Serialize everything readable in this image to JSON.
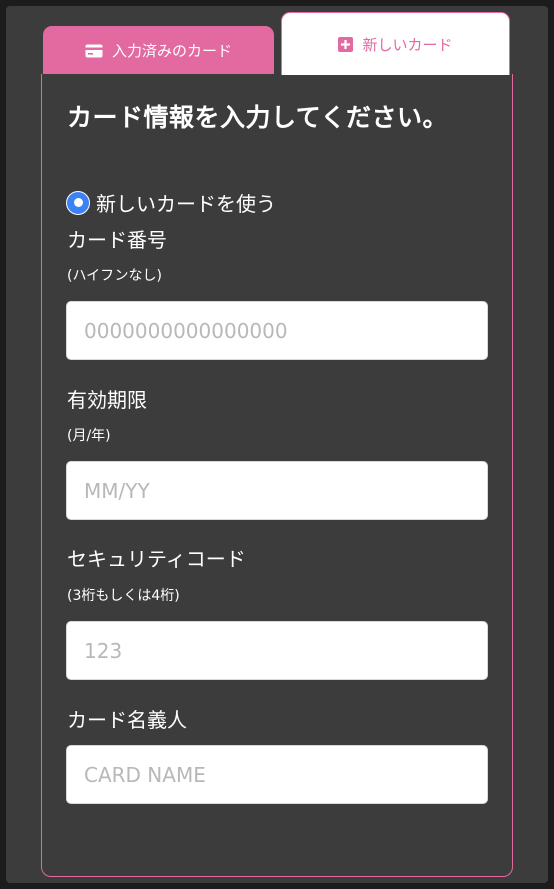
{
  "tabs": {
    "saved": {
      "label": "入力済みのカード",
      "icon": "credit-card-icon"
    },
    "new": {
      "label": "新しいカード",
      "icon": "plus-square-icon",
      "active": true
    }
  },
  "form": {
    "title": "カード情報を入力してください。",
    "radio_label": "新しいカードを使う",
    "radio_selected": true,
    "card_number": {
      "label": "カード番号",
      "hint": "(ハイフンなし)",
      "placeholder": "0000000000000000",
      "value": ""
    },
    "expiry": {
      "label": "有効期限",
      "hint": "(月/年)",
      "placeholder": "MM/YY",
      "value": ""
    },
    "security_code": {
      "label": "セキュリティコード",
      "hint": "(3桁もしくは4桁)",
      "placeholder": "123",
      "value": ""
    },
    "card_name": {
      "label": "カード名義人",
      "placeholder": "CARD NAME",
      "value": ""
    }
  },
  "colors": {
    "accent": "#e26aa0",
    "background": "#3c3c3c",
    "outer": "#1c1c1c",
    "radio": "#3b82f6"
  }
}
